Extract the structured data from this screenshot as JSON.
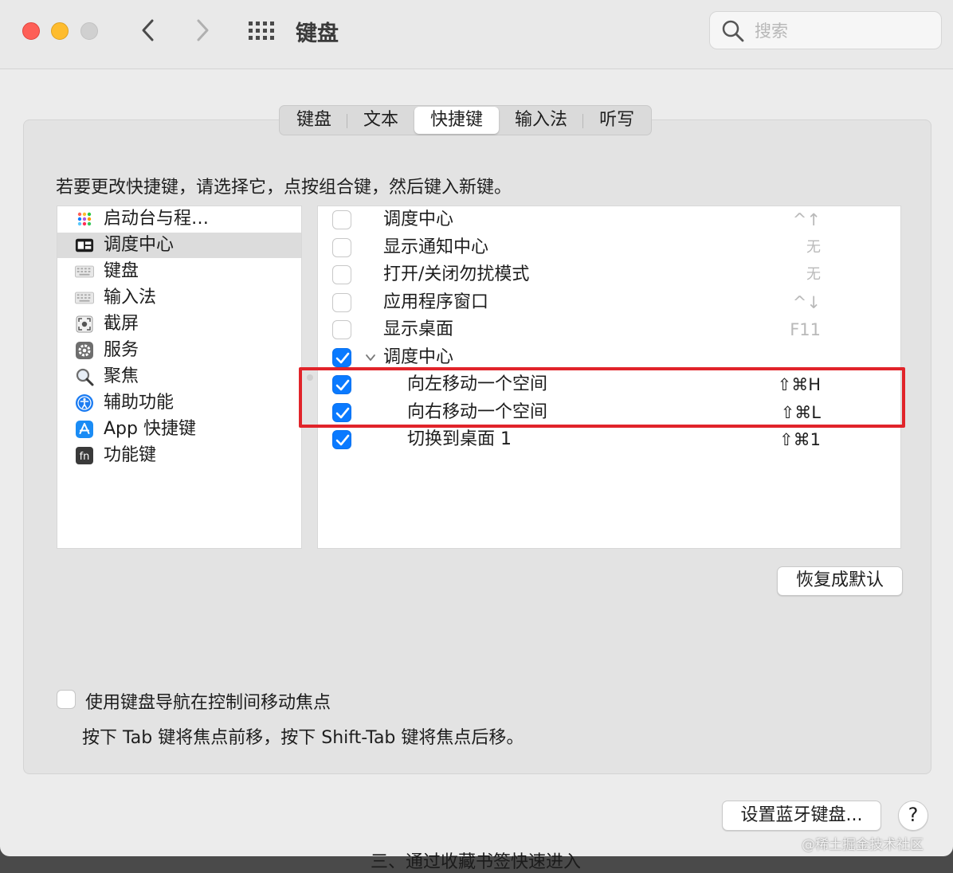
{
  "window": {
    "title": "键盘"
  },
  "search": {
    "placeholder": "搜索"
  },
  "tabs": [
    {
      "label": "键盘",
      "active": false
    },
    {
      "label": "文本",
      "active": false
    },
    {
      "label": "快捷键",
      "active": true
    },
    {
      "label": "输入法",
      "active": false
    },
    {
      "label": "听写",
      "active": false
    }
  ],
  "instruction": "若要更改快捷键，请选择它，点按组合键，然后键入新键。",
  "categories": [
    {
      "label": "启动台与程…",
      "icon": "launchpad-icon",
      "selected": false
    },
    {
      "label": "调度中心",
      "icon": "mission-control-icon",
      "selected": true
    },
    {
      "label": "键盘",
      "icon": "keyboard-icon",
      "selected": false
    },
    {
      "label": "输入法",
      "icon": "input-method-icon",
      "selected": false
    },
    {
      "label": "截屏",
      "icon": "screenshot-icon",
      "selected": false
    },
    {
      "label": "服务",
      "icon": "services-gear-icon",
      "selected": false
    },
    {
      "label": "聚焦",
      "icon": "spotlight-magnifier-icon",
      "selected": false
    },
    {
      "label": "辅助功能",
      "icon": "accessibility-icon",
      "selected": false
    },
    {
      "label": "App 快捷键",
      "icon": "app-store-icon",
      "selected": false
    },
    {
      "label": "功能键",
      "icon": "fn-key-icon",
      "selected": false
    }
  ],
  "shortcuts": [
    {
      "label": "调度中心",
      "key": "^↑",
      "checked": false
    },
    {
      "label": "显示通知中心",
      "key": "无",
      "checked": false
    },
    {
      "label": "打开/关闭勿扰模式",
      "key": "无",
      "checked": false
    },
    {
      "label": "应用程序窗口",
      "key": "^↓",
      "checked": false
    },
    {
      "label": "显示桌面",
      "key": "F11",
      "checked": false
    },
    {
      "label": "调度中心",
      "key": "",
      "checked": true,
      "group": true
    },
    {
      "label": "向左移动一个空间",
      "key": "⇧⌘H",
      "checked": true
    },
    {
      "label": "向右移动一个空间",
      "key": "⇧⌘L",
      "checked": true
    },
    {
      "label": "切换到桌面 1",
      "key": "⇧⌘1",
      "checked": true
    }
  ],
  "buttons": {
    "restore_defaults": "恢复成默认",
    "bluetooth_keyboard": "设置蓝牙键盘...",
    "help": "?"
  },
  "keyboard_navigation": {
    "label": "使用键盘导航在控制间移动焦点",
    "hint": "按下 Tab 键将焦点前移，按下 Shift-Tab 键将焦点后移。",
    "checked": false
  },
  "background_text": "三、通过收藏书签快速进入",
  "watermark": "@稀土掘金技术社区",
  "colors": {
    "accent": "#0a7aff",
    "highlight_box": "#e1242a"
  }
}
